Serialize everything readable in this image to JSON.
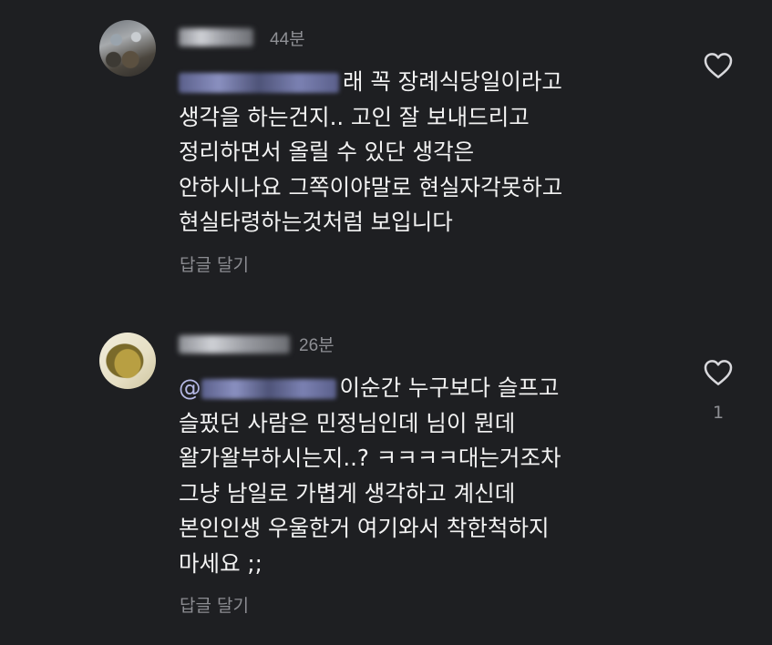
{
  "comments": [
    {
      "time": "44분",
      "text_tail_first": "래 꼭 장례식당일이라고",
      "text_rest": "생각을 하는건지.. 고인 잘 보내드리고\n정리하면서 올릴 수 있단 생각은\n안하시나요 그쪽이야말로 현실자각못하고\n현실타령하는것처럼 보입니다",
      "reply_label": "답글 달기",
      "like_count": ""
    },
    {
      "time": "26분",
      "mention_prefix": "@",
      "text_tail_first": "이순간 누구보다 슬프고",
      "text_rest": "슬펐던 사람은 민정님인데 님이 뭔데\n왈가왈부하시는지..? ㅋㅋㅋㅋ대는거조차\n그냥 남일로 가볍게 생각하고 계신데\n본인인생 우울한거 여기와서 착한척하지\n마세요 ;;",
      "reply_label": "답글 달기",
      "like_count": "1"
    }
  ]
}
